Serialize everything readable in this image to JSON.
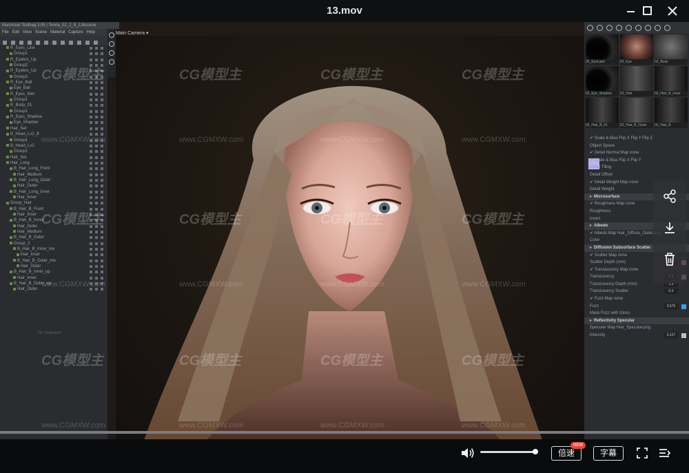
{
  "player": {
    "title": "13.mov",
    "speed_label": "倍速",
    "speed_badge": "NEW",
    "subtitle_label": "字幕",
    "volume_level": 1.0
  },
  "app": {
    "title": "Marmoset Toolbag 3.05 | Tenria_02_2_9_2.tbscene",
    "menu": [
      "File",
      "Edit",
      "View",
      "Scene",
      "Material",
      "Capture",
      "Help"
    ],
    "viewport_label": "Main Camera ▾",
    "outliner_empty": "No Selection",
    "outliner": [
      "R_Eyes_Line",
      "Group1",
      "R_Eyebro_Up",
      "Group2",
      "R_Eyebro_Up",
      "Group3",
      "R_Eye_Ball",
      "Eye_Ball",
      "R_Eyes_Wet",
      "Group1",
      "R_Body_01",
      "Group1",
      "R_Eyes_Shadow",
      "Eye_Shadow",
      "Hair_Set",
      "B_Head_Lv2_B",
      "Group1",
      "B_Head_Lv2",
      "Group1",
      "Hair_Set",
      "Hair_Long",
      "B_Hair_Long_Front",
      "Hair_Medium",
      "B_Hair_Long_Outer",
      "Hair_Outer",
      "B_Hair_Long_Inner",
      "Hair_Inner",
      "Group_Hair",
      "B_Hair_B_Front",
      "Hair_Inner",
      "B_Hair_B_Inner",
      "Hair_Outer",
      "Hair_Medium",
      "B_Hair_B_Outer",
      "Group_3",
      "B_Hair_B_Inner_me",
      "Hair_Inner",
      "B_Hair_B_Outer_me",
      "Hair_Outer",
      "B_Hair_B_Inner_up",
      "Hair_Inner",
      "B_Hair_B_Outer_up",
      "Hair_Outer"
    ],
    "materials": [
      {
        "name": "02_EyeLash",
        "style": "dark"
      },
      {
        "name": "02_Eye",
        "style": "face"
      },
      {
        "name": "02_Body",
        "style": "gray"
      },
      {
        "name": "02_Eye_Shadow",
        "style": "dark"
      },
      {
        "name": "02_Hair",
        "style": "hair"
      },
      {
        "name": "02_Hair_B_Inner",
        "style": "hair2"
      },
      {
        "name": "02_Hair_B_01",
        "style": "hair2"
      },
      {
        "name": "02_Hair_B_Outer",
        "style": "hair"
      },
      {
        "name": "02_Hair_B",
        "style": "hair2"
      }
    ],
    "properties": [
      {
        "type": "row",
        "label": "✔ Scale & Bias     Flip X   Flip Y   Flip Z"
      },
      {
        "type": "row",
        "label": "Object Space"
      },
      {
        "type": "row",
        "label": "✔ Detail Normal Map  none"
      },
      {
        "type": "row",
        "label": "✔ Scale & Bias     Flip X   Flip Y"
      },
      {
        "type": "row",
        "label": "Detail Tiling"
      },
      {
        "type": "row",
        "label": "Detail Offset"
      },
      {
        "type": "row",
        "label": "✔ Detail Weight Map  none"
      },
      {
        "type": "row",
        "label": "Detail Weight"
      },
      {
        "type": "head",
        "label": "Microsurface"
      },
      {
        "type": "row",
        "label": "✔ Roughness Map  none"
      },
      {
        "type": "row",
        "label": "Roughness"
      },
      {
        "type": "row",
        "label": "Invert"
      },
      {
        "type": "head",
        "label": "Albedo"
      },
      {
        "type": "row",
        "label": "✔ Albedo Map  Hair_Diffuse_Outer.png"
      },
      {
        "type": "row",
        "label": "Color"
      },
      {
        "type": "head",
        "label": "Diffusion    Subsurface Scatter"
      },
      {
        "type": "row",
        "label": "✔ Scatter Map  none"
      },
      {
        "type": "row",
        "label": "Scatter Depth (mm)",
        "num": "20.6",
        "pin": "#e8a0a0"
      },
      {
        "type": "row",
        "label": "✔ Translucency Map  none"
      },
      {
        "type": "row",
        "label": "Translucency",
        "num": "0.8",
        "pin": "#e8a0a0"
      },
      {
        "type": "row",
        "label": "Translucency Depth (mm)",
        "num": "1.9"
      },
      {
        "type": "row",
        "label": "Translucency Scatter",
        "num": "0.3"
      },
      {
        "type": "row",
        "label": "✔ Fuzz Map  none"
      },
      {
        "type": "row",
        "label": "Fuzz",
        "num": "0.575",
        "pin": "#3aa0e0"
      },
      {
        "type": "row",
        "label": "Mask Fuzz with Gloss"
      },
      {
        "type": "head",
        "label": "Reflectivity    Specular"
      },
      {
        "type": "row",
        "label": "Specular Map  Hair_Specular.png"
      },
      {
        "type": "row",
        "label": "Intensity",
        "num": "0.127",
        "pin": "#c0c0c0"
      }
    ]
  },
  "watermark": {
    "logo": "CG模型主",
    "url": "www.CGMXW.com"
  },
  "icons": {
    "share": "share-icon",
    "download": "download-icon",
    "delete": "trash-icon",
    "volume": "speaker-icon",
    "fullscreen": "fullscreen-icon",
    "playlist": "playlist-icon"
  }
}
